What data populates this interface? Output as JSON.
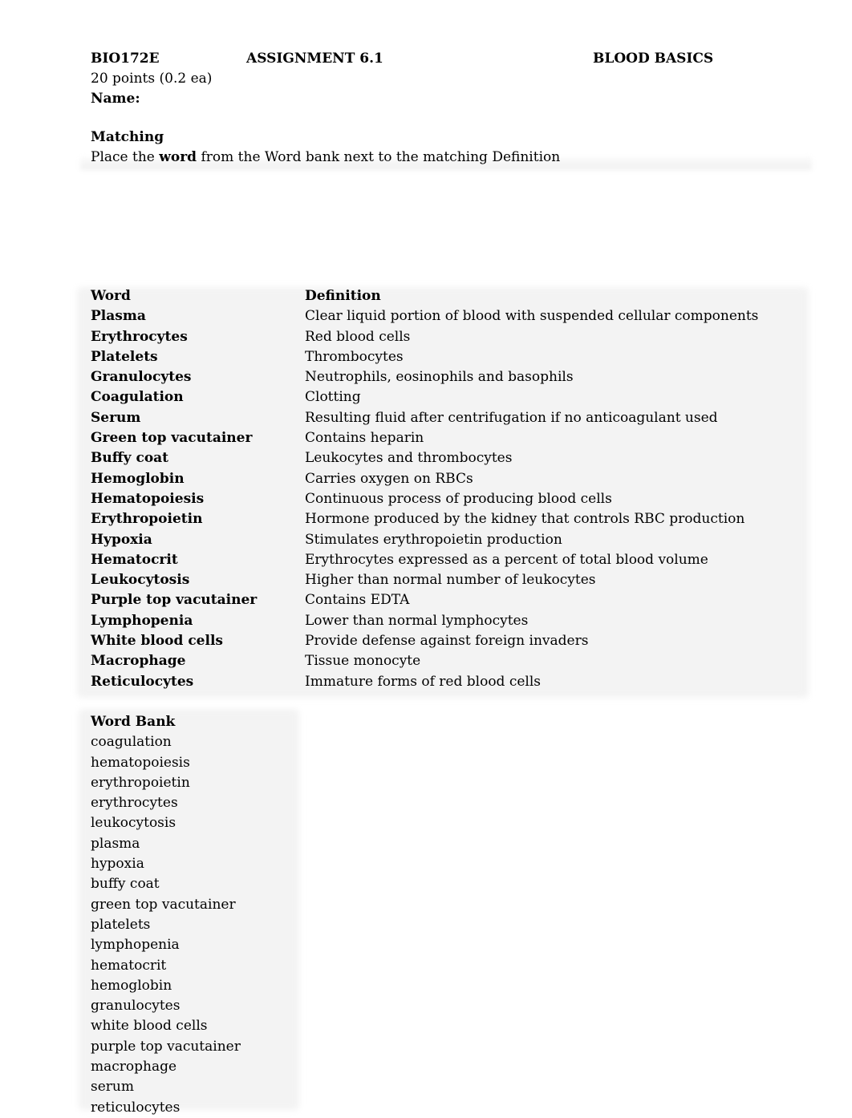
{
  "header": {
    "course": "BIO172E",
    "assignment": "ASSIGNMENT 6.1",
    "title": "BLOOD BASICS",
    "points": "20  points (0.2 ea)",
    "name_label": "Name:"
  },
  "section": {
    "heading": "Matching",
    "instruction_before": "Place the ",
    "instruction_bold": "word",
    "instruction_after": " from the Word bank next to the matching Definition"
  },
  "table": {
    "headers": {
      "word": "Word",
      "definition": "Definition"
    },
    "rows": [
      {
        "word": "Plasma",
        "definition": "Clear liquid portion of blood with suspended cellular components"
      },
      {
        "word": "Erythrocytes",
        "definition": "Red blood cells"
      },
      {
        "word": "Platelets",
        "definition": "Thrombocytes"
      },
      {
        "word": "Granulocytes",
        "definition": "Neutrophils, eosinophils and basophils"
      },
      {
        "word": "Coagulation",
        "definition": "Clotting"
      },
      {
        "word": "Serum",
        "definition": "Resulting fluid after centrifugation if no anticoagulant used"
      },
      {
        "word": "Green top vacutainer",
        "definition": "Contains heparin"
      },
      {
        "word": "Buffy coat",
        "definition": "Leukocytes and thrombocytes"
      },
      {
        "word": "Hemoglobin",
        "definition": "Carries oxygen on RBCs"
      },
      {
        "word": "Hematopoiesis",
        "definition": "Continuous process of producing  blood cells"
      },
      {
        "word": "Erythropoietin",
        "definition": "Hormone produced by the kidney that controls RBC production"
      },
      {
        "word": "Hypoxia",
        "definition": "Stimulates erythropoietin production"
      },
      {
        "word": "Hematocrit",
        "definition": "Erythrocytes expressed as a percent of total blood volume"
      },
      {
        "word": "Leukocytosis",
        "definition": "Higher than normal number of leukocytes"
      },
      {
        "word": "Purple top vacutainer",
        "definition": "Contains EDTA"
      },
      {
        "word": "Lymphopenia",
        "definition": "Lower than normal lymphocytes"
      },
      {
        "word": "White blood cells",
        "definition": "Provide defense against foreign invaders"
      },
      {
        "word": "Macrophage",
        "definition": "Tissue monocyte"
      },
      {
        "word": "Reticulocytes",
        "definition": "Immature forms of red blood cells"
      }
    ]
  },
  "word_bank": {
    "title": "Word Bank",
    "items": [
      "coagulation",
      "hematopoiesis",
      "erythropoietin",
      "erythrocytes",
      "leukocytosis",
      "plasma",
      "hypoxia",
      "buffy coat",
      "green top vacutainer",
      "platelets",
      "lymphopenia",
      "hematocrit",
      "hemoglobin",
      "granulocytes",
      "white blood cells",
      "purple top vacutainer",
      "macrophage",
      "serum",
      "reticulocytes"
    ]
  }
}
